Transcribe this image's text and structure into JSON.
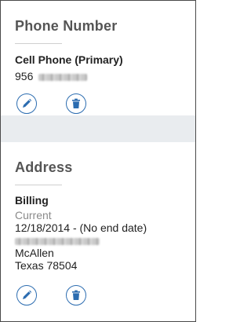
{
  "phone_section": {
    "title": "Phone Number",
    "entry_label": "Cell Phone (Primary)",
    "number_prefix": "956"
  },
  "address_section": {
    "title": "Address",
    "entry_label": "Billing",
    "status": "Current",
    "date_range": "12/18/2014 - (No end date)",
    "city": "McAllen",
    "state_zip": "Texas 78504"
  },
  "icons": {
    "edit": "pencil-icon",
    "delete": "trash-icon",
    "accent_color": "#2b6cb0"
  }
}
